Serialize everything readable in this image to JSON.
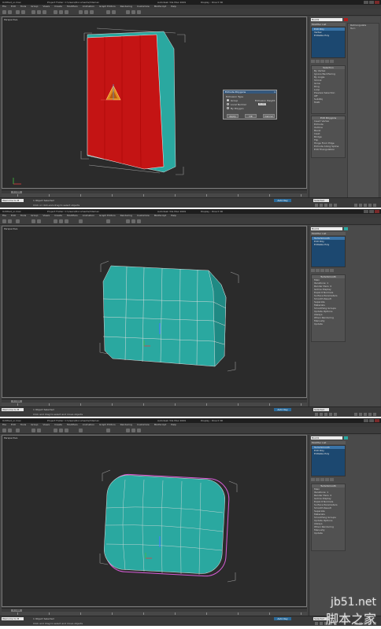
{
  "window": {
    "title": "Untitled_ui.max",
    "project": "Project Folder: C:\\Users\\Documents\\3dsmax",
    "app_name": "Autodesk 3ds Max 2009",
    "display": "Display : Direct 3D"
  },
  "menu": [
    "File",
    "Edit",
    "Tools",
    "Group",
    "Views",
    "Create",
    "Modifiers",
    "Animation",
    "Graph Editors",
    "Rendering",
    "Customize",
    "MAXScript",
    "Help"
  ],
  "panels": [
    {
      "viewport_label": "Perspective",
      "object_name": "Box01",
      "modifier_list": "Modifier List",
      "stack": [
        "Edit Poly",
        "Vertex",
        "Editable Poly"
      ],
      "time_slider": "0 / 100",
      "status": "1 Object Selected",
      "prompt": "Click or click-and-drag to select objects",
      "maxscript": "Welcome to M",
      "selection": "Selected",
      "key_mode": "Auto Key"
    },
    {
      "viewport_label": "Perspective",
      "object_name": "Box01",
      "modifier_list": "Modifier List",
      "stack": [
        "TurboSmooth",
        "Edit Poly",
        "Editable Poly"
      ],
      "time_slider": "0 / 100",
      "status": "1 Object Selected",
      "prompt": "Click and drag to select and move objects",
      "maxscript": "Welcome to M",
      "selection": "Selected",
      "key_mode": "Auto Key"
    },
    {
      "viewport_label": "Perspective",
      "object_name": "Box01",
      "modifier_list": "Modifier List",
      "stack": [
        "TurboSmooth",
        "Edit Poly",
        "Editable Poly"
      ],
      "time_slider": "0 / 100",
      "status": "1 Object Selected",
      "prompt": "Click and drag to select and move objects",
      "maxscript": "Welcome to M",
      "selection": "Selected",
      "key_mode": "Auto Key"
    }
  ],
  "rollouts": {
    "selection": {
      "title": "Selection",
      "items": [
        "By Vertex",
        "Ignore Backfacing",
        "By Angle",
        "Shrink",
        "Grow",
        "Ring",
        "Loop",
        "Preview Selection",
        "Off",
        "SubObj",
        "Multi"
      ]
    },
    "edit_polygons": {
      "title": "Edit Polygons",
      "items": [
        "Insert Vertex",
        "Extrude",
        "Outline",
        "Bevel",
        "Inset",
        "Bridge",
        "Flip",
        "Hinge From Edge",
        "Extrude Along Spline",
        "Edit Triangulation",
        "Retriangulate",
        "Turn"
      ]
    },
    "turbosmooth": {
      "title": "TurboSmooth",
      "main": "Main",
      "iterations_label": "Iterations:",
      "iterations_value": "1",
      "render_iters_label": "Render Iters:",
      "render_iters_value": "0",
      "isoline": "Isoline Display",
      "explicit": "Explicit Normals",
      "surface": "Surface Parameters",
      "smooth_result": "Smooth Result",
      "separate": "Separate",
      "materials": "Materials",
      "smoothing_groups": "Smoothing Groups",
      "update": "Update Options",
      "always": "Always",
      "when_rendering": "When Rendering",
      "manually": "Manually",
      "update_btn": "Update"
    }
  },
  "dialog": {
    "title": "Extrude Polygons",
    "close": "x",
    "extrusion_type": "Extrusion Type",
    "group": "Group",
    "local_normal": "Local Normal",
    "by_polygon": "By Polygon",
    "height_label": "Extrusion Height:",
    "height_value": "10.0mm",
    "apply": "Apply",
    "ok": "OK",
    "cancel": "Cancel"
  },
  "watermark": {
    "url": "jb51.net",
    "cn": "脚本之家"
  },
  "colors": {
    "viewport_bg": "#2b2b2b",
    "red_face": "#c41414",
    "teal_face": "#2aa8a0",
    "selection_blue": "#3a74a8",
    "turbo_outline": "#d85cd8"
  }
}
